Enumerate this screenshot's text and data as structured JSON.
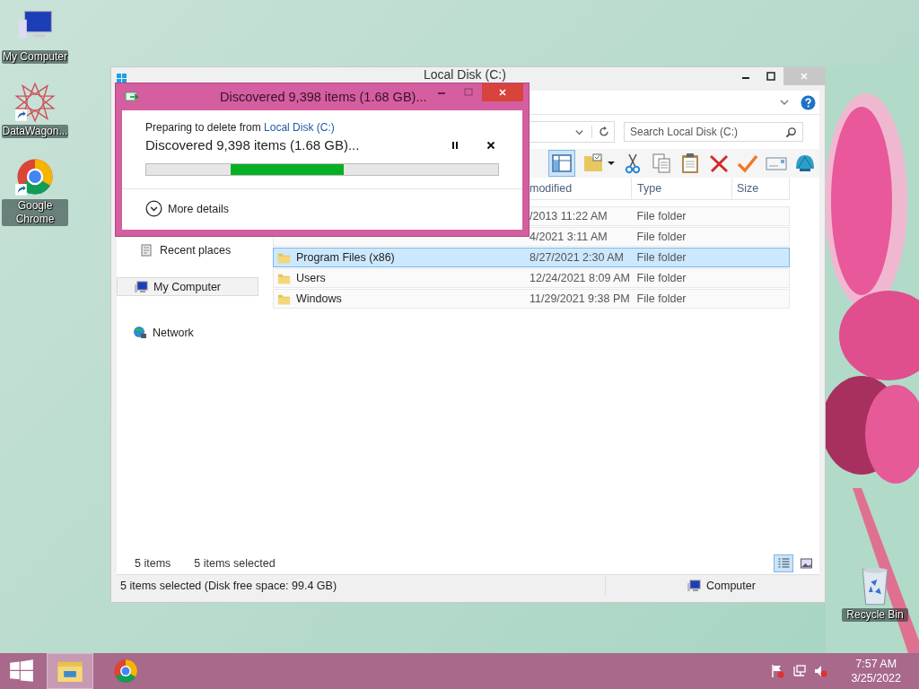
{
  "desktop": {
    "icons": [
      {
        "label": "My Computer",
        "kind": "computer",
        "shortcut": false
      },
      {
        "label": "DataWagon...",
        "kind": "star",
        "shortcut": true
      },
      {
        "label": "Google Chrome",
        "kind": "chrome",
        "shortcut": true
      }
    ],
    "corner_icons": [
      {
        "label": "Recycle Bin",
        "kind": "recycle",
        "shortcut": false
      }
    ]
  },
  "explorer": {
    "title": "Local Disk (C:)",
    "search": {
      "placeholder": "Search Local Disk (C:)"
    },
    "columns": [
      "modified",
      "Type",
      "Size"
    ],
    "nav": [
      {
        "label": "Recent places",
        "kind": "recent",
        "selected": false
      },
      {
        "label": "My Computer",
        "kind": "computer",
        "selected": true
      },
      {
        "label": "Network",
        "kind": "network",
        "selected": false
      }
    ],
    "rows": [
      {
        "date": "/2013 11:22 AM",
        "type": "File folder",
        "selected": false
      },
      {
        "date": "4/2021 3:11 AM",
        "type": "File folder",
        "selected": false
      },
      {
        "name": "Program Files (x86)",
        "date": "8/27/2021 2:30 AM",
        "type": "File folder",
        "selected": true
      },
      {
        "name": "Users",
        "date": "12/24/2021 8:09 AM",
        "type": "File folder",
        "selected": false
      },
      {
        "name": "Windows",
        "date": "11/29/2021 9:38 PM",
        "type": "File folder",
        "selected": false
      }
    ],
    "item_count": "5 items",
    "selection_count": "5 items selected",
    "views": [
      {
        "kind": "details",
        "selected": true
      },
      {
        "kind": "preview",
        "selected": false
      }
    ],
    "status_bar": {
      "text": "5 items selected (Disk free space: 99.4 GB)",
      "location": "Computer"
    }
  },
  "dialog": {
    "title": "Discovered 9,398 items (1.68 GB)...",
    "caption": "Preparing to delete from",
    "caption_link": "Local Disk (C:)",
    "heading": "Discovered 9,398 items (1.68 GB)...",
    "more": "More details"
  },
  "taskbar": {
    "apps": [
      {
        "kind": "explorer",
        "selected": true
      },
      {
        "kind": "chrome",
        "selected": false
      }
    ],
    "time": "7:57 AM",
    "date": "3/25/2022"
  }
}
